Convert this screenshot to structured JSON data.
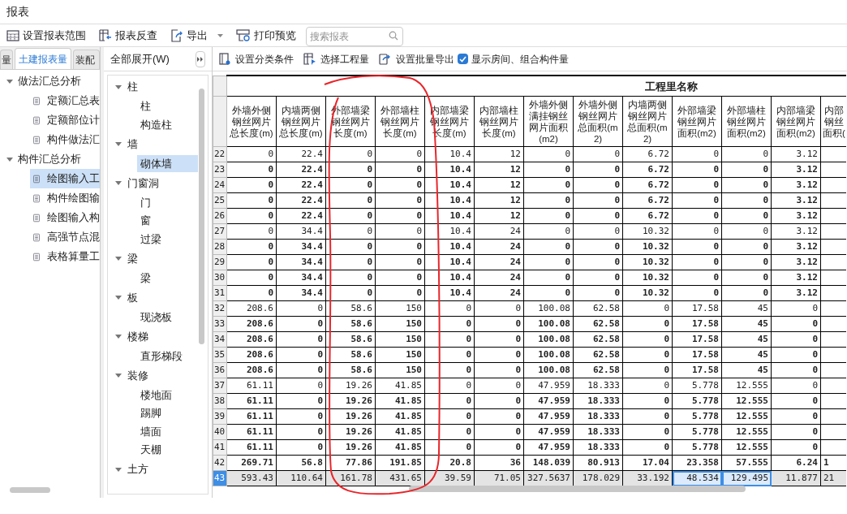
{
  "window": {
    "title": "报表"
  },
  "toolbar": [
    {
      "kind": "range",
      "label": "设置报表范围",
      "has_menu": false
    },
    {
      "kind": "reverse",
      "label": "报表反查",
      "has_menu": false
    },
    {
      "kind": "export",
      "label": "导出",
      "has_menu": true
    },
    {
      "kind": "print",
      "label": "打印预览",
      "has_menu": false
    }
  ],
  "search": {
    "placeholder": "搜索报表"
  },
  "left_tabs": [
    {
      "label": "量",
      "selected": false
    },
    {
      "label": "土建报表量",
      "selected": true
    },
    {
      "label": "装配",
      "selected": false
    }
  ],
  "report_tree": [
    {
      "label": "做法汇总分析",
      "expanded": true,
      "children": [
        {
          "label": "定额汇总表",
          "selected": false
        },
        {
          "label": "定额部位计",
          "selected": false
        },
        {
          "label": "构件做法汇",
          "selected": false
        }
      ]
    },
    {
      "label": "构件汇总分析",
      "expanded": true,
      "children": [
        {
          "label": "绘图输入工",
          "selected": true
        },
        {
          "label": "构件绘图输",
          "selected": false
        },
        {
          "label": "绘图输入构",
          "selected": false
        },
        {
          "label": "高强节点混",
          "selected": false
        },
        {
          "label": "表格算量工",
          "selected": false
        }
      ]
    }
  ],
  "component_panel": {
    "expand_all": "全部展开(W)",
    "tree": [
      {
        "label": "柱",
        "expanded": true,
        "children": [
          {
            "label": "柱",
            "selected": false
          },
          {
            "label": "构造柱",
            "selected": false
          }
        ]
      },
      {
        "label": "墙",
        "expanded": true,
        "children": [
          {
            "label": "砌体墙",
            "selected": true
          }
        ]
      },
      {
        "label": "门窗洞",
        "expanded": true,
        "children": [
          {
            "label": "门",
            "selected": false
          },
          {
            "label": "窗",
            "selected": false
          },
          {
            "label": "过梁",
            "selected": false
          }
        ]
      },
      {
        "label": "梁",
        "expanded": true,
        "children": [
          {
            "label": "梁",
            "selected": false
          }
        ]
      },
      {
        "label": "板",
        "expanded": true,
        "children": [
          {
            "label": "现浇板",
            "selected": false
          }
        ]
      },
      {
        "label": "楼梯",
        "expanded": true,
        "children": [
          {
            "label": "直形梯段",
            "selected": false
          }
        ]
      },
      {
        "label": "装修",
        "expanded": true,
        "children": [
          {
            "label": "楼地面",
            "selected": false
          },
          {
            "label": "踢脚",
            "selected": false
          },
          {
            "label": "墙面",
            "selected": false
          },
          {
            "label": "天棚",
            "selected": false
          }
        ]
      },
      {
        "label": "土方",
        "expanded": true
      }
    ]
  },
  "grid_toolbar": {
    "buttons": [
      {
        "kind": "filter",
        "label": "设置分类条件"
      },
      {
        "kind": "select",
        "label": "选择工程量"
      },
      {
        "kind": "batch",
        "label": "设置批量导出"
      }
    ],
    "checkbox": {
      "label": "显示房间、组合构件量",
      "checked": true
    }
  },
  "table": {
    "group_header": "工程里名称",
    "columns": [
      {
        "header": "外墙外侧钢丝网片总长度(m)",
        "selected": false
      },
      {
        "header": "内墙两侧钢丝网片总长度(m)",
        "selected": false
      },
      {
        "header": "外部墙梁钢丝网片长度(m)",
        "selected": false
      },
      {
        "header": "外部墙柱钢丝网片长度(m)",
        "selected": false
      },
      {
        "header": "内部墙梁钢丝网片长度(m)",
        "selected": false
      },
      {
        "header": "内部墙柱钢丝网片长度(m)",
        "selected": false
      },
      {
        "header": "外墙外侧满挂钢丝网片面积(m2)",
        "selected": false
      },
      {
        "header": "外墙外侧钢丝网片总面积(m2)",
        "selected": false
      },
      {
        "header": "内墙两侧钢丝网片总面积(m2)",
        "selected": false
      },
      {
        "header": "外部墙梁钢丝网片面积(m2)",
        "selected": true
      },
      {
        "header": "外部墙柱钢丝网片面积(m2)",
        "selected": true
      },
      {
        "header": "内部墙梁钢丝网片面积(m2)",
        "selected": false
      },
      {
        "header": "内部钢丝面积(",
        "selected": false
      }
    ],
    "rows": [
      {
        "number": "22",
        "kind": "plain",
        "selected": false,
        "cells": [
          "0",
          "22.4",
          "0",
          "0",
          "10.4",
          "12",
          "0",
          "0",
          "6.72",
          "0",
          "0",
          "3.12",
          ""
        ]
      },
      {
        "number": "23",
        "kind": "bold",
        "selected": false,
        "cells": [
          "0",
          "22.4",
          "0",
          "0",
          "10.4",
          "12",
          "0",
          "0",
          "6.72",
          "0",
          "0",
          "3.12",
          ""
        ]
      },
      {
        "number": "24",
        "kind": "bold",
        "selected": false,
        "cells": [
          "0",
          "22.4",
          "0",
          "0",
          "10.4",
          "12",
          "0",
          "0",
          "6.72",
          "0",
          "0",
          "3.12",
          ""
        ]
      },
      {
        "number": "25",
        "kind": "bold",
        "selected": false,
        "cells": [
          "0",
          "22.4",
          "0",
          "0",
          "10.4",
          "12",
          "0",
          "0",
          "6.72",
          "0",
          "0",
          "3.12",
          ""
        ]
      },
      {
        "number": "26",
        "kind": "bold",
        "selected": false,
        "cells": [
          "0",
          "22.4",
          "0",
          "0",
          "10.4",
          "12",
          "0",
          "0",
          "6.72",
          "0",
          "0",
          "3.12",
          ""
        ]
      },
      {
        "number": "27",
        "kind": "plain",
        "selected": false,
        "cells": [
          "0",
          "34.4",
          "0",
          "0",
          "10.4",
          "24",
          "0",
          "0",
          "10.32",
          "0",
          "0",
          "3.12",
          ""
        ]
      },
      {
        "number": "28",
        "kind": "bold",
        "selected": false,
        "cells": [
          "0",
          "34.4",
          "0",
          "0",
          "10.4",
          "24",
          "0",
          "0",
          "10.32",
          "0",
          "0",
          "3.12",
          ""
        ]
      },
      {
        "number": "29",
        "kind": "bold",
        "selected": false,
        "cells": [
          "0",
          "34.4",
          "0",
          "0",
          "10.4",
          "24",
          "0",
          "0",
          "10.32",
          "0",
          "0",
          "3.12",
          ""
        ]
      },
      {
        "number": "30",
        "kind": "bold",
        "selected": false,
        "cells": [
          "0",
          "34.4",
          "0",
          "0",
          "10.4",
          "24",
          "0",
          "0",
          "10.32",
          "0",
          "0",
          "3.12",
          ""
        ]
      },
      {
        "number": "31",
        "kind": "bold",
        "selected": false,
        "cells": [
          "0",
          "34.4",
          "0",
          "0",
          "10.4",
          "24",
          "0",
          "0",
          "10.32",
          "0",
          "0",
          "3.12",
          ""
        ]
      },
      {
        "number": "32",
        "kind": "plain",
        "selected": false,
        "cells": [
          "208.6",
          "0",
          "58.6",
          "150",
          "0",
          "0",
          "100.08",
          "62.58",
          "0",
          "17.58",
          "45",
          "0",
          ""
        ]
      },
      {
        "number": "33",
        "kind": "bold",
        "selected": false,
        "cells": [
          "208.6",
          "0",
          "58.6",
          "150",
          "0",
          "0",
          "100.08",
          "62.58",
          "0",
          "17.58",
          "45",
          "0",
          ""
        ]
      },
      {
        "number": "34",
        "kind": "bold",
        "selected": false,
        "cells": [
          "208.6",
          "0",
          "58.6",
          "150",
          "0",
          "0",
          "100.08",
          "62.58",
          "0",
          "17.58",
          "45",
          "0",
          ""
        ]
      },
      {
        "number": "35",
        "kind": "bold",
        "selected": false,
        "cells": [
          "208.6",
          "0",
          "58.6",
          "150",
          "0",
          "0",
          "100.08",
          "62.58",
          "0",
          "17.58",
          "45",
          "0",
          ""
        ]
      },
      {
        "number": "36",
        "kind": "bold",
        "selected": false,
        "cells": [
          "208.6",
          "0",
          "58.6",
          "150",
          "0",
          "0",
          "100.08",
          "62.58",
          "0",
          "17.58",
          "45",
          "0",
          ""
        ]
      },
      {
        "number": "37",
        "kind": "plain",
        "selected": false,
        "cells": [
          "61.11",
          "0",
          "19.26",
          "41.85",
          "0",
          "0",
          "47.959",
          "18.333",
          "0",
          "5.778",
          "12.555",
          "0",
          ""
        ]
      },
      {
        "number": "38",
        "kind": "bold",
        "selected": false,
        "cells": [
          "61.11",
          "0",
          "19.26",
          "41.85",
          "0",
          "0",
          "47.959",
          "18.333",
          "0",
          "5.778",
          "12.555",
          "0",
          ""
        ]
      },
      {
        "number": "39",
        "kind": "bold",
        "selected": false,
        "cells": [
          "61.11",
          "0",
          "19.26",
          "41.85",
          "0",
          "0",
          "47.959",
          "18.333",
          "0",
          "5.778",
          "12.555",
          "0",
          ""
        ]
      },
      {
        "number": "40",
        "kind": "bold",
        "selected": false,
        "cells": [
          "61.11",
          "0",
          "19.26",
          "41.85",
          "0",
          "0",
          "47.959",
          "18.333",
          "0",
          "5.778",
          "12.555",
          "0",
          ""
        ]
      },
      {
        "number": "41",
        "kind": "bold",
        "selected": false,
        "cells": [
          "61.11",
          "0",
          "19.26",
          "41.85",
          "0",
          "0",
          "47.959",
          "18.333",
          "0",
          "5.778",
          "12.555",
          "0",
          ""
        ]
      },
      {
        "number": "42",
        "kind": "bold",
        "selected": false,
        "cells": [
          "269.71",
          "56.8",
          "77.86",
          "191.85",
          "20.8",
          "36",
          "148.039",
          "80.913",
          "17.04",
          "23.358",
          "57.555",
          "6.24",
          "1"
        ]
      },
      {
        "number": "43",
        "kind": "total",
        "selected": true,
        "cells": [
          "593.43",
          "110.64",
          "161.78",
          "431.65",
          "39.59",
          "71.05",
          "327.5637",
          "178.029",
          "33.192",
          "48.534",
          "129.495",
          "11.877",
          "21"
        ]
      }
    ]
  }
}
